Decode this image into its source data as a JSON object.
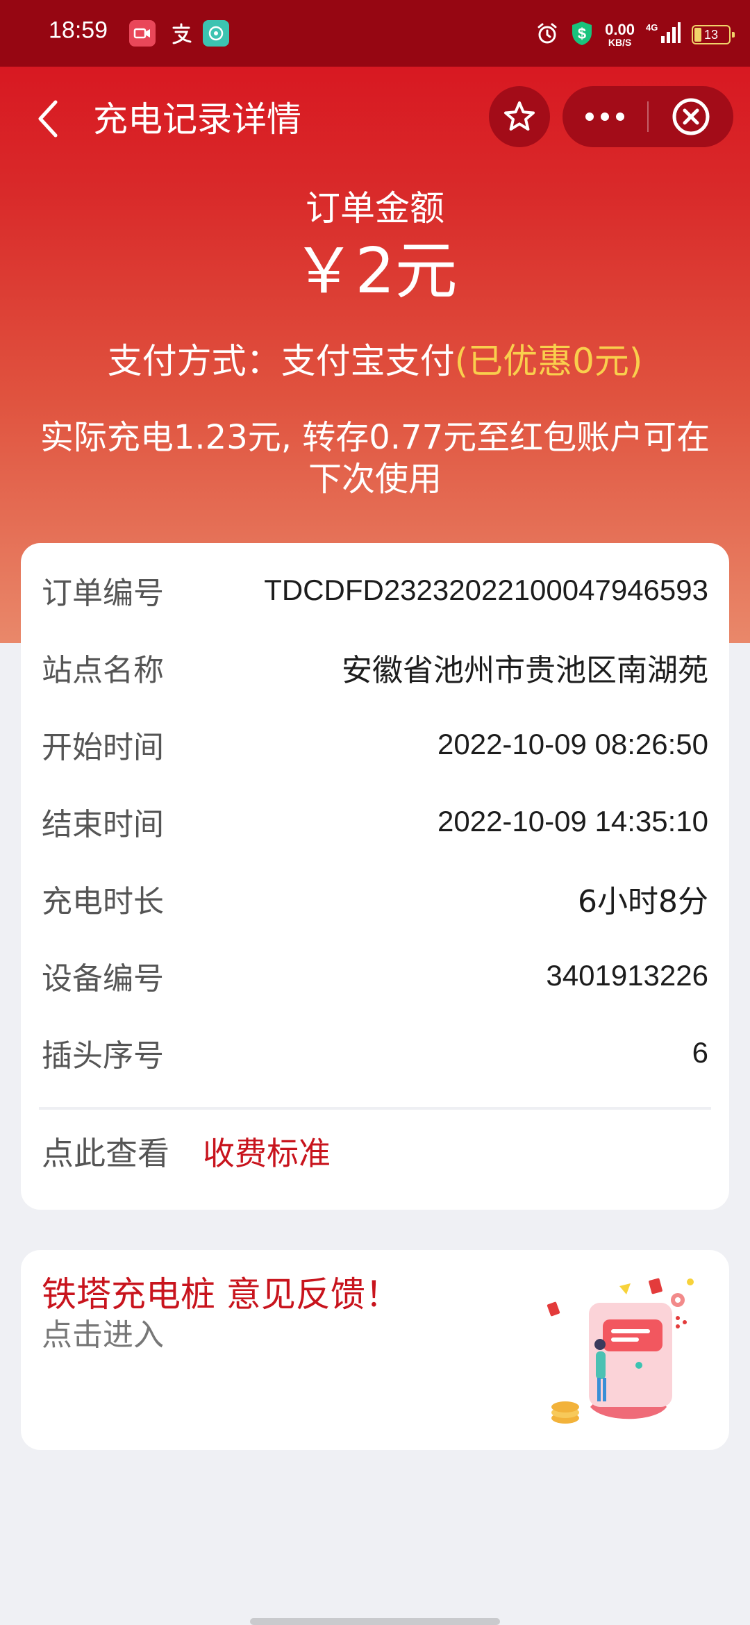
{
  "status_bar": {
    "time": "18:59",
    "speed_value": "0.00",
    "speed_unit": "KB/S",
    "network": "4G",
    "battery": "13"
  },
  "nav": {
    "title": "充电记录详情"
  },
  "summary": {
    "amount_label": "订单金额",
    "amount_value": "￥2元",
    "payment_prefix": "支付方式：支付宝支付",
    "payment_discount": "(已优惠0元)",
    "actual_note": "实际充电1.23元, 转存0.77元至红包账户可在下次使用"
  },
  "details": [
    {
      "label": "订单编号",
      "value": "TDCDFD23232022100047946593"
    },
    {
      "label": "站点名称",
      "value": "安徽省池州市贵池区南湖苑"
    },
    {
      "label": "开始时间",
      "value": "2022-10-09 08:26:50"
    },
    {
      "label": "结束时间",
      "value": "2022-10-09 14:35:10"
    },
    {
      "label": "充电时长",
      "value": "6小时8分"
    },
    {
      "label": "设备编号",
      "value": "3401913226"
    },
    {
      "label": "插头序号",
      "value": "6"
    }
  ],
  "fee": {
    "label": "点此查看",
    "link": "收费标准"
  },
  "feedback": {
    "title": "铁塔充电桩 意见反馈！",
    "subtitle": "点击进入"
  },
  "colors": {
    "brand_red": "#d80f1d",
    "status_bar": "#960612",
    "discount_yellow": "#f9cf4d",
    "link_red": "#c8141d"
  },
  "icons": [
    "back-arrow-icon",
    "star-icon",
    "more-dots-icon",
    "close-circle-icon",
    "alarm-icon",
    "dollar-shield-icon",
    "signal-icon",
    "battery-icon"
  ]
}
